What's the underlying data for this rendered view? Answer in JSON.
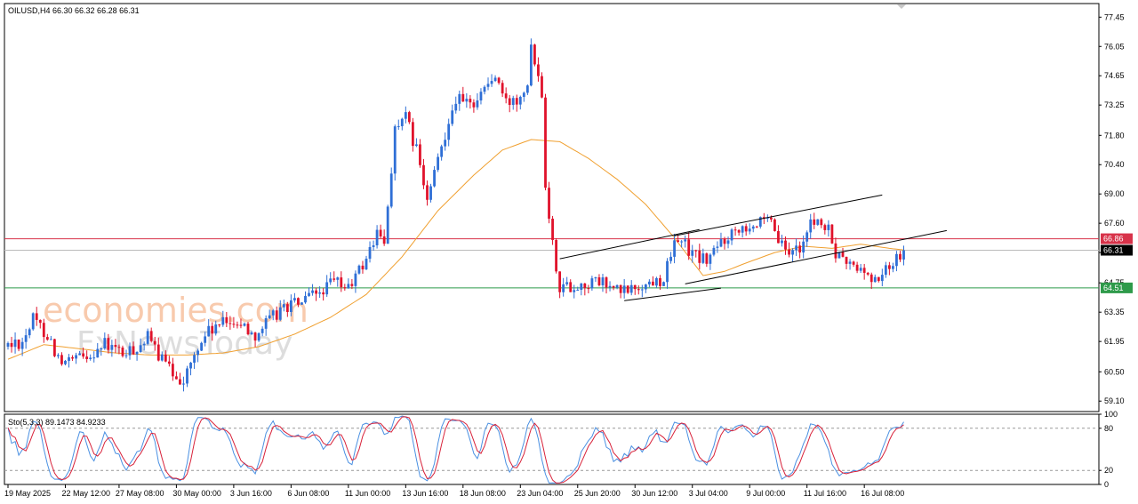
{
  "header": {
    "symbol_text": "OILUSD,H4  66.30 66.32 66.28 66.31",
    "osc_text": "Sto(5,3,3) 89.1473 84.9233"
  },
  "watermark": {
    "line1": "economies.com",
    "line2": "FxNewsToday"
  },
  "colors": {
    "bull": "#2f6fd6",
    "bear": "#e0122b",
    "ma": "#f0a030",
    "resistance": "#d8334a",
    "support": "#2e9a4a",
    "price_tag": "#000000",
    "stoch_k": "#4a90e2",
    "stoch_d": "#d8223a"
  },
  "chart_data": {
    "type": "candlestick",
    "price_axis": {
      "ylim": [
        58.6,
        78.1
      ],
      "ticks": [
        "77.45",
        "76.05",
        "74.65",
        "73.25",
        "71.80",
        "70.40",
        "69.00",
        "67.60",
        "66.20",
        "64.75",
        "63.35",
        "61.95",
        "60.50",
        "59.10"
      ]
    },
    "time_axis": {
      "labels": [
        "19 May 2025",
        "22 May 12:00",
        "27 May 08:00",
        "30 May 00:00",
        "3 Jun 16:00",
        "6 Jun 08:00",
        "11 Jun 00:00",
        "13 Jun 16:00",
        "18 Jun 08:00",
        "23 Jun 04:00",
        "25 Jun 20:00",
        "30 Jun 12:00",
        "3 Jul 04:00",
        "9 Jul 00:00",
        "11 Jul 16:00",
        "16 Jul 08:00"
      ],
      "label_bar_index": [
        0,
        16,
        31,
        47,
        63,
        79,
        95,
        111,
        127,
        143,
        159,
        175,
        191,
        207,
        223,
        239
      ],
      "bar_count": 251
    },
    "levels": [
      {
        "name": "resistance",
        "value": 66.86,
        "label": "66.86"
      },
      {
        "name": "current",
        "value": 66.31,
        "label": "66.31"
      },
      {
        "name": "support",
        "value": 64.51,
        "label": "64.51"
      }
    ],
    "channels": [
      {
        "name": "first-channel",
        "upper": [
          [
            154,
            65.9
          ],
          [
            193,
            67.3
          ]
        ],
        "lower": [
          [
            172,
            63.9
          ],
          [
            199,
            64.5
          ]
        ]
      },
      {
        "name": "second-channel",
        "upper": [
          [
            186,
            67.0
          ],
          [
            244,
            68.95
          ]
        ],
        "lower": [
          [
            189,
            64.7
          ],
          [
            262,
            67.25
          ]
        ]
      }
    ],
    "ma_keypoints": [
      [
        0,
        61.1
      ],
      [
        10,
        61.8
      ],
      [
        20,
        61.6
      ],
      [
        30,
        61.4
      ],
      [
        40,
        61.3
      ],
      [
        50,
        61.3
      ],
      [
        60,
        61.4
      ],
      [
        70,
        61.7
      ],
      [
        80,
        62.3
      ],
      [
        90,
        63.1
      ],
      [
        100,
        64.2
      ],
      [
        110,
        66.0
      ],
      [
        120,
        68.2
      ],
      [
        130,
        69.9
      ],
      [
        138,
        71.1
      ],
      [
        146,
        71.6
      ],
      [
        154,
        71.5
      ],
      [
        162,
        70.7
      ],
      [
        170,
        69.7
      ],
      [
        178,
        68.5
      ],
      [
        186,
        66.9
      ],
      [
        194,
        65.1
      ],
      [
        200,
        65.3
      ],
      [
        206,
        65.7
      ],
      [
        214,
        66.2
      ],
      [
        222,
        66.5
      ],
      [
        230,
        66.4
      ],
      [
        238,
        66.6
      ],
      [
        246,
        66.4
      ],
      [
        251,
        66.3
      ]
    ],
    "price_keypoints": [
      [
        0,
        61.7
      ],
      [
        5,
        62.0
      ],
      [
        8,
        63.0
      ],
      [
        12,
        62.3
      ],
      [
        16,
        60.8
      ],
      [
        22,
        61.2
      ],
      [
        28,
        61.8
      ],
      [
        34,
        61.3
      ],
      [
        40,
        62.1
      ],
      [
        46,
        60.6
      ],
      [
        50,
        60.1
      ],
      [
        56,
        62.3
      ],
      [
        60,
        62.7
      ],
      [
        64,
        63.0
      ],
      [
        70,
        62.3
      ],
      [
        78,
        63.6
      ],
      [
        84,
        63.9
      ],
      [
        88,
        64.3
      ],
      [
        92,
        64.8
      ],
      [
        96,
        64.5
      ],
      [
        100,
        65.6
      ],
      [
        104,
        67.1
      ],
      [
        106,
        66.6
      ],
      [
        109,
        72.1
      ],
      [
        112,
        72.6
      ],
      [
        115,
        71.1
      ],
      [
        118,
        68.6
      ],
      [
        121,
        70.6
      ],
      [
        124,
        72.6
      ],
      [
        126,
        73.6
      ],
      [
        130,
        73.2
      ],
      [
        134,
        74.1
      ],
      [
        137,
        74.6
      ],
      [
        140,
        73.3
      ],
      [
        143,
        73.6
      ],
      [
        146,
        74.4
      ],
      [
        147,
        76.3
      ],
      [
        150,
        73.9
      ],
      [
        151,
        69.6
      ],
      [
        153,
        66.6
      ],
      [
        155,
        64.6
      ],
      [
        160,
        64.6
      ],
      [
        166,
        64.8
      ],
      [
        172,
        64.3
      ],
      [
        178,
        64.6
      ],
      [
        184,
        65.0
      ],
      [
        188,
        67.0
      ],
      [
        192,
        66.1
      ],
      [
        196,
        65.8
      ],
      [
        200,
        66.7
      ],
      [
        205,
        67.5
      ],
      [
        210,
        67.6
      ],
      [
        214,
        67.5
      ],
      [
        218,
        66.1
      ],
      [
        222,
        66.5
      ],
      [
        226,
        67.8
      ],
      [
        230,
        67.2
      ],
      [
        232,
        66.1
      ],
      [
        236,
        65.6
      ],
      [
        240,
        65.3
      ],
      [
        242,
        64.8
      ],
      [
        246,
        65.3
      ],
      [
        249,
        66.0
      ],
      [
        251,
        66.31
      ]
    ],
    "stochastic": {
      "name": "Sto(5,3,3)",
      "k_last": 89.1473,
      "d_last": 84.9233,
      "ylim": [
        0,
        100
      ],
      "ticks": [
        "100",
        "80",
        "20",
        "0"
      ],
      "levels": [
        80,
        20
      ]
    }
  }
}
